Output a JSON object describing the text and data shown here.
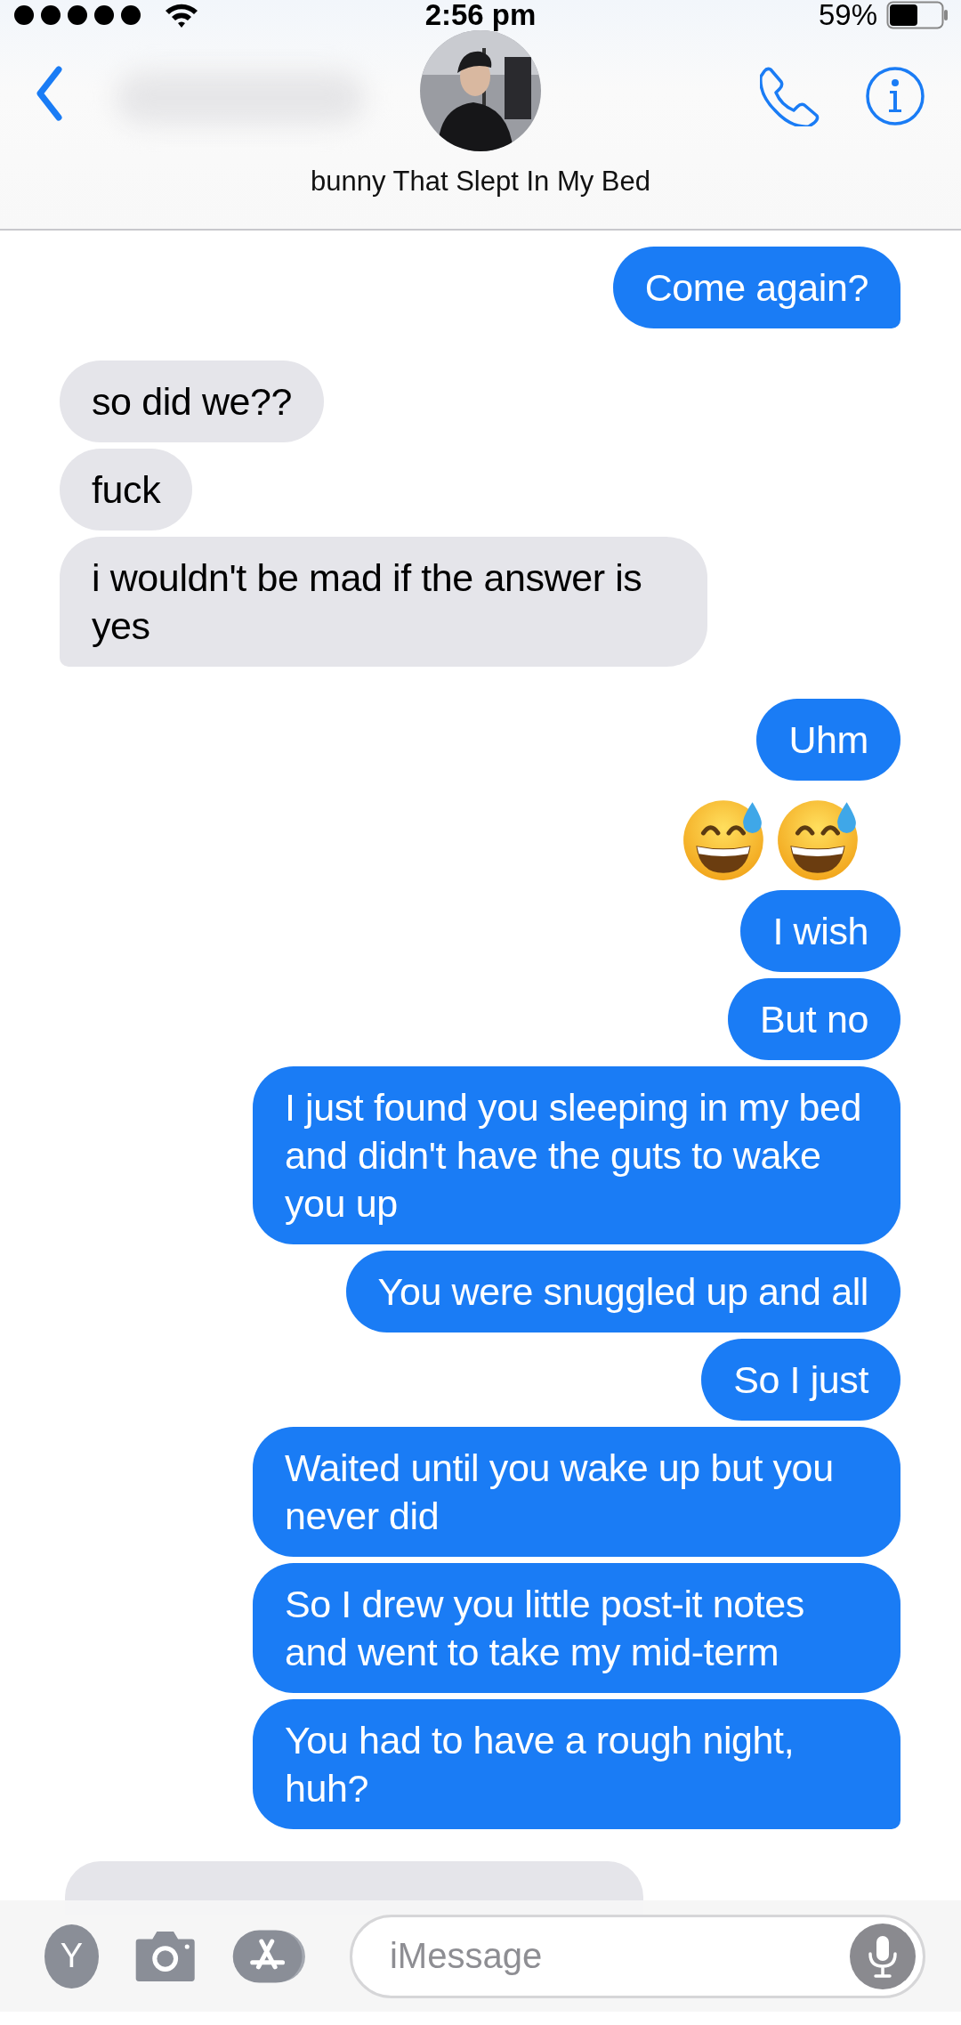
{
  "status_bar": {
    "time": "2:56 pm",
    "battery": "59%"
  },
  "header": {
    "contact_name": "bunny That Slept In My Bed"
  },
  "messages": [
    {
      "kind": "text",
      "outgoing": true,
      "text": "Come again?",
      "tail": true
    },
    {
      "kind": "text",
      "outgoing": false,
      "text": "so did we??",
      "tail": false
    },
    {
      "kind": "text",
      "outgoing": false,
      "text": "fuck",
      "tail": false
    },
    {
      "kind": "text",
      "outgoing": false,
      "text": "i wouldn't be mad if the answer is yes",
      "tail": true
    },
    {
      "kind": "text",
      "outgoing": true,
      "text": "Uhm",
      "tail": false
    },
    {
      "kind": "emoji",
      "outgoing": true,
      "emojis": [
        {
          "kind": "sweat-smile"
        },
        {
          "kind": "sweat-smile"
        }
      ]
    },
    {
      "kind": "text",
      "outgoing": true,
      "text": "I wish",
      "tail": false
    },
    {
      "kind": "text",
      "outgoing": true,
      "text": "But no",
      "tail": false
    },
    {
      "kind": "text",
      "outgoing": true,
      "text": "I just found you sleeping in my bed and didn't have the guts to wake you up",
      "tail": false
    },
    {
      "kind": "text",
      "outgoing": true,
      "text": "You were snuggled up and all",
      "tail": false
    },
    {
      "kind": "text",
      "outgoing": true,
      "text": "So I just",
      "tail": false
    },
    {
      "kind": "text",
      "outgoing": true,
      "text": "Waited until you wake up but you never did",
      "tail": false
    },
    {
      "kind": "text",
      "outgoing": true,
      "text": "So I drew you little post-it notes and went to take my mid-term",
      "tail": false
    },
    {
      "kind": "text",
      "outgoing": true,
      "text": "You had to have a rough night, huh?",
      "tail": true
    },
    {
      "kind": "partial",
      "outgoing": false
    }
  ],
  "input_bar": {
    "avatar_letter": "Y",
    "placeholder": "iMessage"
  }
}
